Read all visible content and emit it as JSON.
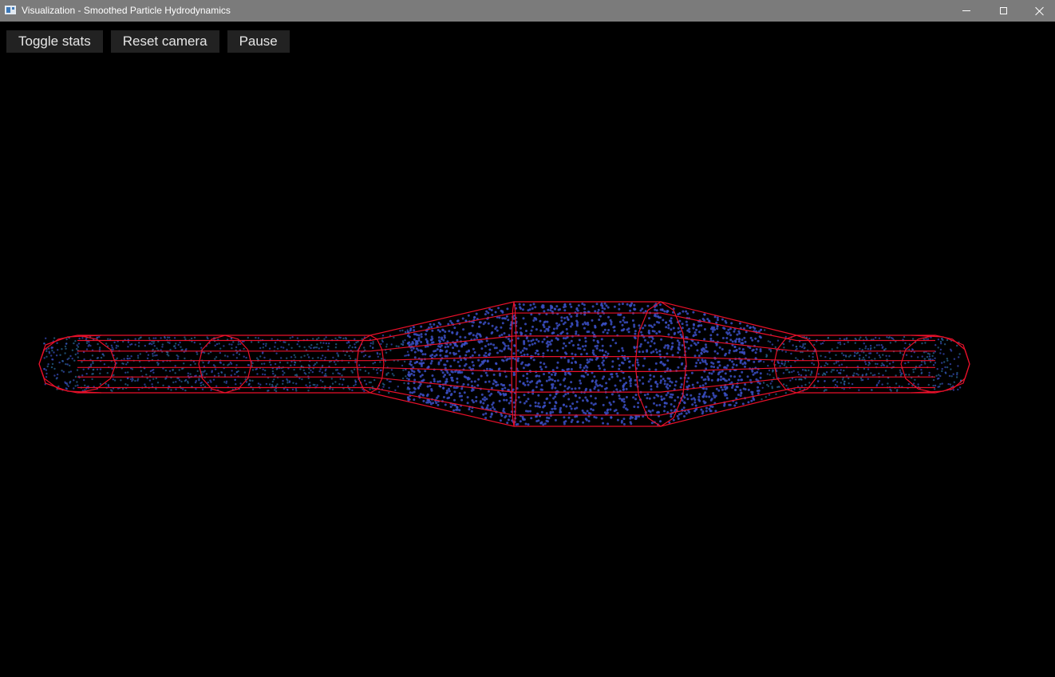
{
  "window": {
    "title": "Visualization - Smoothed Particle Hydrodynamics",
    "icon": "app-window-icon",
    "controls": [
      "minimize-icon",
      "maximize-icon",
      "close-icon"
    ]
  },
  "toolbar": {
    "toggle_stats": "Toggle stats",
    "reset_camera": "Reset camera",
    "pause": "Pause"
  },
  "scene": {
    "background_color": "#000000",
    "wireframe_color": "#e8102a",
    "particle_color": "#3b4fc4",
    "particle_color_dim": "#2a6a9a"
  }
}
